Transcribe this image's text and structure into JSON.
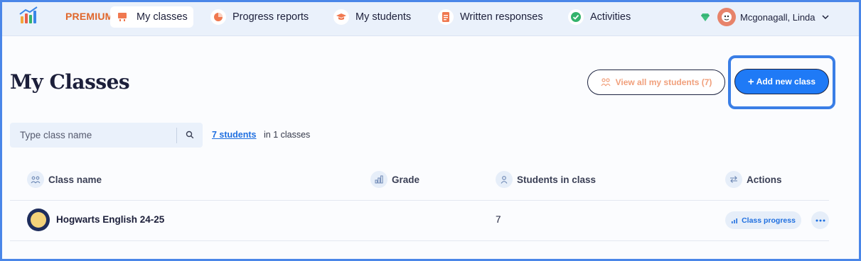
{
  "nav": {
    "premium_label": "PREMIUM",
    "items": [
      {
        "label": "My classes",
        "icon": "chalkboard-icon",
        "active": true
      },
      {
        "label": "Progress reports",
        "icon": "pie-chart-icon",
        "active": false
      },
      {
        "label": "My students",
        "icon": "graduation-cap-icon",
        "active": false
      },
      {
        "label": "Written responses",
        "icon": "document-icon",
        "active": false
      },
      {
        "label": "Activities",
        "icon": "check-circle-icon",
        "active": false
      }
    ],
    "user": {
      "name": "Mcgonagall, Linda",
      "icons": [
        "gem-icon",
        "avatar",
        "chevron-down-icon"
      ]
    }
  },
  "header": {
    "title": "My Classes",
    "view_all_label": "View all my students (7)",
    "add_class_label": "Add new class"
  },
  "search": {
    "placeholder": "Type class name",
    "value": "",
    "students_link": "7 students",
    "students_suffix": "in 1 classes"
  },
  "table": {
    "columns": [
      {
        "label": "Class name",
        "icon": "users-icon"
      },
      {
        "label": "Grade",
        "icon": "bar-chart-icon"
      },
      {
        "label": "Students in class",
        "icon": "user-icon"
      },
      {
        "label": "Actions",
        "icon": "swap-arrows-icon"
      }
    ],
    "rows": [
      {
        "class_name": "Hogwarts English 24-25",
        "grade": "",
        "students": "7",
        "progress_label": "Class progress"
      }
    ]
  },
  "colors": {
    "accent": "#1f7af6",
    "premium": "#e0662b",
    "nav_background": "#eaf1fb",
    "view_all_text": "#f1a07c",
    "focus_ring": "#3a7ee6"
  }
}
